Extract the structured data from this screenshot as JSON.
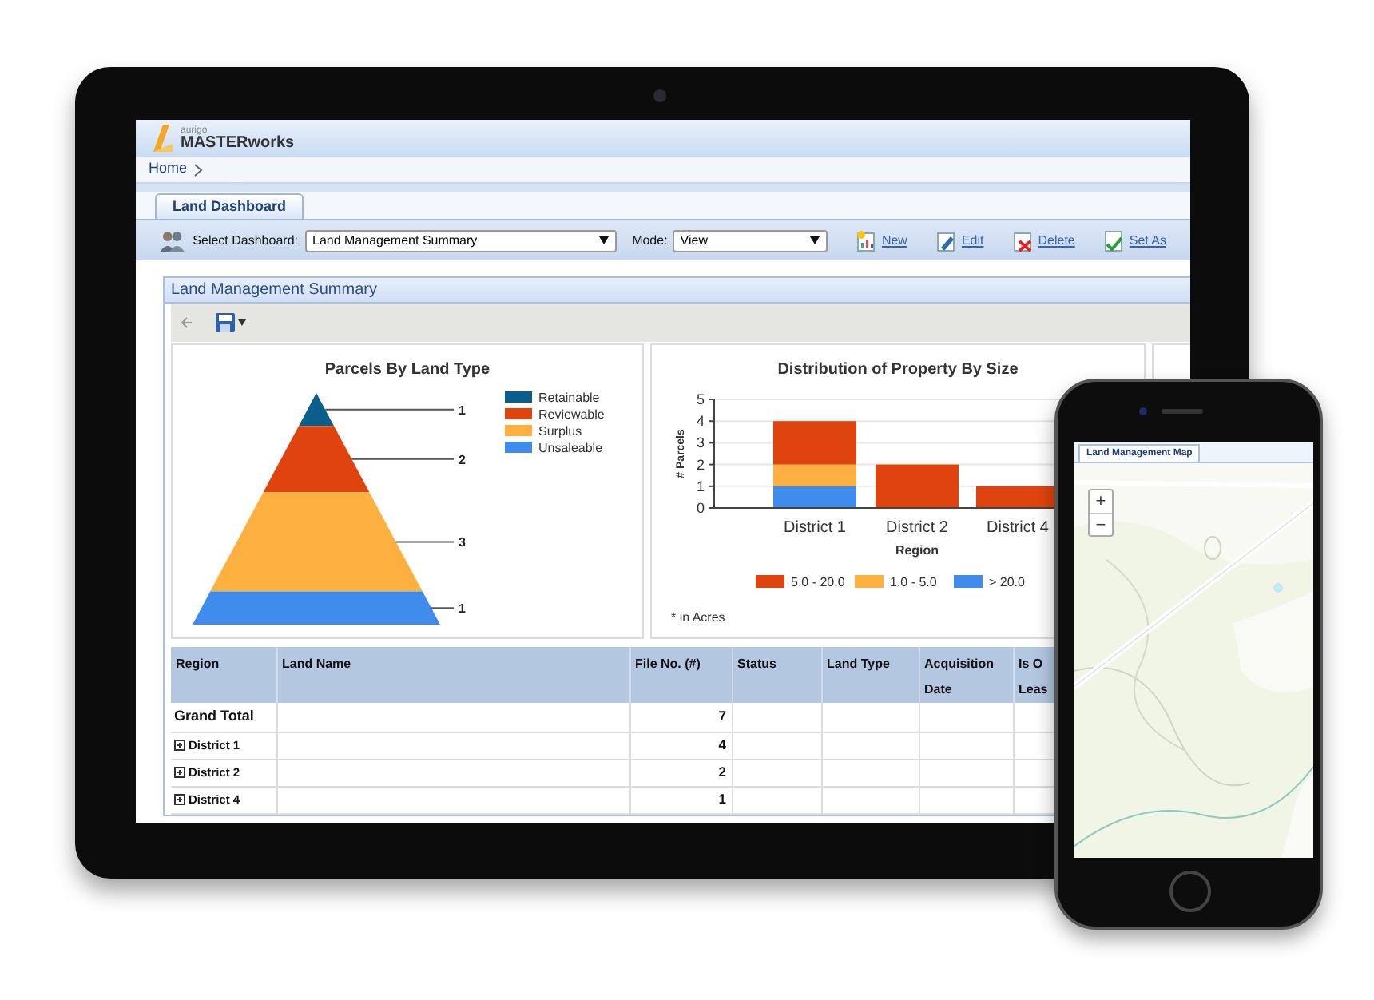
{
  "logo": {
    "brand": "aurigo",
    "product": "MASTERworks"
  },
  "breadcrumb": [
    "Home"
  ],
  "tabs": [
    {
      "label": "Land Dashboard",
      "selected": true
    }
  ],
  "toolbar": {
    "dashboard_label": "Select Dashboard:",
    "dashboard_value": "Land Management Summary",
    "mode_label": "Mode:",
    "mode_value": "View",
    "actions": [
      {
        "label": "New",
        "kind": "new"
      },
      {
        "label": "Edit",
        "kind": "edit"
      },
      {
        "label": "Delete",
        "kind": "delete"
      },
      {
        "label": "Set As",
        "kind": "set"
      }
    ]
  },
  "panel": {
    "title": "Land Management Summary"
  },
  "pyramid": {
    "title": "Parcels By Land Type",
    "segments": [
      {
        "label": "Retainable",
        "value": "1",
        "color": "#0b5e8c"
      },
      {
        "label": "Reviewable",
        "value": "2",
        "color": "#e0440e"
      },
      {
        "label": "Surplus",
        "value": "3",
        "color": "#fbb040"
      },
      {
        "label": "Unsaleable",
        "value": "1",
        "color": "#3f8cec"
      }
    ]
  },
  "bar_chart": {
    "chart_data": {
      "type": "bar",
      "title": "Distribution of Property By Size",
      "xlabel": "Region",
      "ylabel": "# Parcels",
      "categories": [
        "District 1",
        "District 2",
        "District 4"
      ],
      "stacked": true,
      "ylim": [
        0,
        5
      ],
      "grid": true,
      "legend": "bottom",
      "yticks": [
        0,
        1,
        2,
        3,
        4,
        5
      ],
      "series": [
        {
          "name": "5.0 - 20.0",
          "color": "#e0440e",
          "values": [
            2,
            2,
            1
          ]
        },
        {
          "name": "1.0 - 5.0",
          "color": "#fbb040",
          "values": [
            1,
            null,
            null
          ]
        },
        {
          "name": "> 20.0",
          "color": "#3f8cec",
          "values": [
            1,
            null,
            null
          ]
        }
      ]
    },
    "note": "* in Acres"
  },
  "table": {
    "columns": [
      "Region",
      "Land Name",
      "File No. (#)",
      "Status",
      "Land Type",
      "Acquisition Date",
      "Is O Leas"
    ],
    "rows": [
      {
        "region": "Grand Total",
        "file_no": "7",
        "expandable": false
      },
      {
        "region": "District 1",
        "file_no": "4",
        "expandable": true
      },
      {
        "region": "District 2",
        "file_no": "2",
        "expandable": true
      },
      {
        "region": "District 4",
        "file_no": "1",
        "expandable": true
      }
    ]
  },
  "phone": {
    "tab": "Land Management Map",
    "zoom": [
      "+",
      "−"
    ],
    "map": {
      "kind": "picture"
    }
  }
}
